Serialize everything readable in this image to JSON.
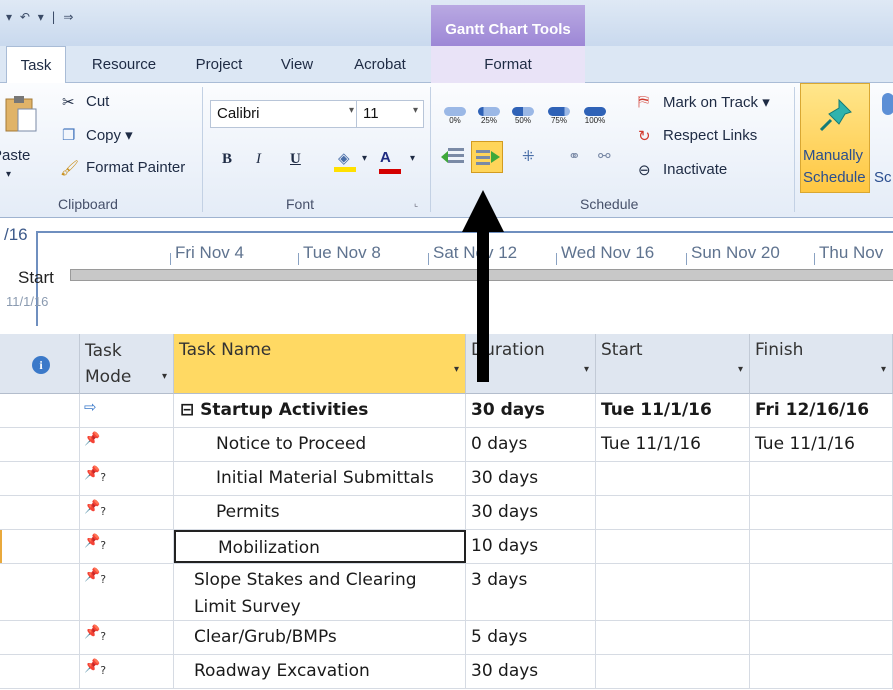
{
  "titlebar": {
    "qat": "▾ ↶ ▾ | ⇒",
    "contextual": "Gantt Chart Tools"
  },
  "tabs": [
    "Task",
    "Resource",
    "Project",
    "View",
    "Acrobat",
    "Format"
  ],
  "clipboard": {
    "paste": "Paste",
    "cut": "Cut",
    "copy": "Copy ▾",
    "format_painter": "Format Painter",
    "group": "Clipboard"
  },
  "font": {
    "family": "Calibri",
    "size": "11",
    "bold": "B",
    "italic": "I",
    "underline": "U",
    "color_a": "A",
    "group": "Font"
  },
  "schedule": {
    "pct": [
      "0%",
      "25%",
      "50%",
      "75%",
      "100%"
    ],
    "mark_on_track": "Mark on Track ▾",
    "respect_links": "Respect Links",
    "inactivate": "Inactivate",
    "group": "Schedule"
  },
  "tasks_group": {
    "manual1": "Manually",
    "manual2": "Schedule",
    "auto_partial": "Sc"
  },
  "timeline": {
    "left_date": "/16",
    "dates": [
      "Fri Nov 4",
      "Tue Nov 8",
      "Sat Nov 12",
      "Wed Nov 16",
      "Sun Nov 20",
      "Thu Nov"
    ],
    "start_label": "Start",
    "start_date": "11/1/16"
  },
  "grid": {
    "headers": {
      "info": "i",
      "mode": "Task Mode",
      "name": "Task Name",
      "duration": "Duration",
      "start": "Start",
      "finish": "Finish"
    },
    "rows": [
      {
        "mode": "auto",
        "name": "⊟ Startup Activities",
        "duration": "30 days",
        "start": "Tue 11/1/16",
        "finish": "Fri 12/16/16",
        "bold": true,
        "indent": 0
      },
      {
        "mode": "manual",
        "name": "Notice to Proceed",
        "duration": "0 days",
        "start": "Tue 11/1/16",
        "finish": "Tue 11/1/16",
        "indent": 1
      },
      {
        "mode": "manual-q",
        "name": "Initial Material Submittals",
        "duration": "30 days",
        "start": "",
        "finish": "",
        "indent": 1
      },
      {
        "mode": "manual-q",
        "name": "Permits",
        "duration": "30 days",
        "start": "",
        "finish": "",
        "indent": 1
      },
      {
        "mode": "manual-q",
        "name": "Mobilization",
        "duration": "10 days",
        "start": "",
        "finish": "",
        "indent": 1,
        "selected": true
      },
      {
        "mode": "manual-q",
        "name": "Slope Stakes and Clearing",
        "name2": "Limit Survey",
        "duration": "3 days",
        "start": "",
        "finish": "",
        "indent": 0,
        "tall": true
      },
      {
        "mode": "manual-q",
        "name": "Clear/Grub/BMPs",
        "duration": "5 days",
        "start": "",
        "finish": "",
        "indent": 0
      },
      {
        "mode": "manual-q",
        "name": "Roadway Excavation",
        "duration": "30 days",
        "start": "",
        "finish": "",
        "indent": 0
      }
    ]
  }
}
